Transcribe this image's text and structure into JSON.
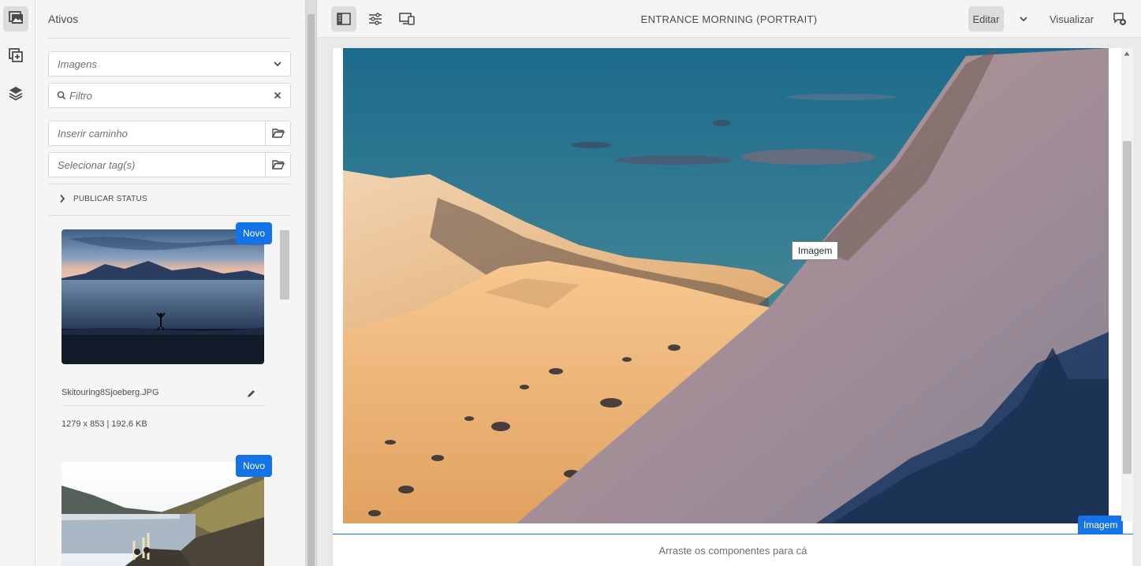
{
  "rail": {
    "items": [
      {
        "name": "assets-panel",
        "icon": "assets-icon"
      },
      {
        "name": "components-panel",
        "icon": "components-add-icon"
      },
      {
        "name": "content-tree",
        "icon": "layers-icon"
      }
    ]
  },
  "panel": {
    "title": "Ativos",
    "asset_type": "Imagens",
    "filter_placeholder": "Filtro",
    "path_placeholder": "Inserir caminho",
    "tags_placeholder": "Selecionar tag(s)",
    "publish_status_label": "PUBLICAR STATUS",
    "assets": [
      {
        "badge": "Novo",
        "filename": "Skitouring8Sjoeberg.JPG",
        "meta": "1279 x 853 | 192.6 KB"
      },
      {
        "badge": "Novo"
      }
    ]
  },
  "toolbar": {
    "page_title": "ENTRANCE MORNING (PORTRAIT)",
    "edit_label": "Editar",
    "preview_label": "Visualizar"
  },
  "editor": {
    "hover_label": "Imagem",
    "component_label": "Imagem",
    "dropzone_text": "Arraste os componentes para cá"
  },
  "colors": {
    "accent": "#1473e6",
    "panel_bg": "#f5f5f5",
    "canvas_bg": "#eaeaea"
  }
}
